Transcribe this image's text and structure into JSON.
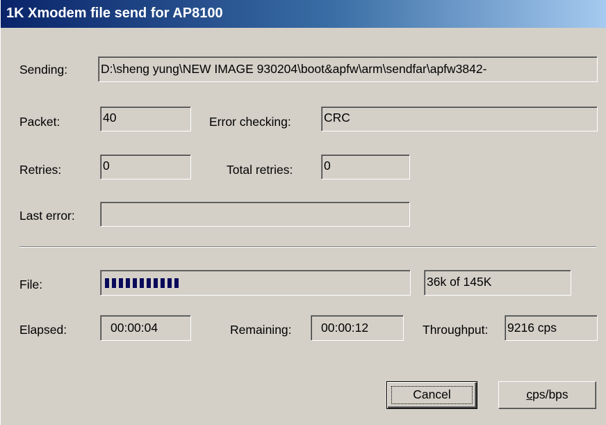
{
  "window": {
    "title": "1K Xmodem file send for AP8100"
  },
  "sending": {
    "label": "Sending:",
    "value": "D:\\sheng yung\\NEW IMAGE 930204\\boot&apfw\\arm\\sendfar\\apfw3842-"
  },
  "packet": {
    "label": "Packet:",
    "value": "40"
  },
  "error_checking": {
    "label": "Error checking:",
    "value": "CRC"
  },
  "retries": {
    "label": "Retries:",
    "value": "0"
  },
  "total_retries": {
    "label": "Total retries:",
    "value": "0"
  },
  "last_error": {
    "label": "Last error:",
    "value": ""
  },
  "file": {
    "label": "File:",
    "progress_fraction": 0.248,
    "progress_text": "36k of 145K"
  },
  "elapsed": {
    "label": "Elapsed:",
    "value": "00:00:04"
  },
  "remaining": {
    "label": "Remaining:",
    "value": "00:00:12"
  },
  "throughput": {
    "label": "Throughput:",
    "value": "9216 cps"
  },
  "buttons": {
    "cancel": "Cancel",
    "cps_bps_first": "c",
    "cps_bps_rest": "ps/bps"
  },
  "colors": {
    "title_gradient_start": "#0a246a",
    "title_gradient_end": "#a6caf0",
    "face": "#d4d0c8",
    "progress": "#0a0a5a"
  }
}
